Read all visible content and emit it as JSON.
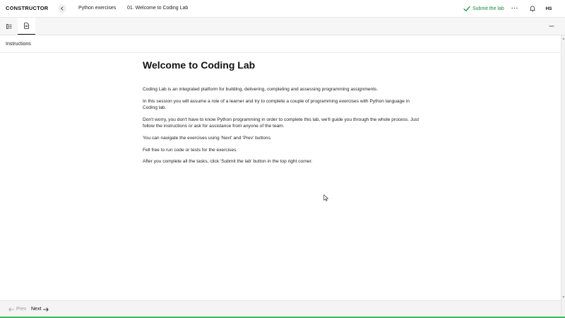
{
  "header": {
    "logo_text_left": "C",
    "logo_text_right": "NSTRUCTOR",
    "breadcrumb_course": "Python exercises",
    "breadcrumb_lesson": "01. Welcome to Coding Lab",
    "submit_label": "Submit the lab",
    "user_initials": "HS"
  },
  "toolbar": {
    "left_icon": "list-icon",
    "active_icon": "document-icon",
    "right_icon": "minus-icon"
  },
  "panel": {
    "title": "Instructions"
  },
  "content": {
    "heading": "Welcome to Coding Lab",
    "paragraphs": [
      "Coding Lab is an integrated platform for building, delivering, completing and assessing programming assignments.",
      "In this session you will assume a role of a learner and try to complete a couple of programming exercises with Python language in Coding lab.",
      "Don't worry, you don't have to know Python programming in order to complete this lab, we'll guide you through the whole process. Just follow the instructions or ask for assistance from anyone of the team.",
      "You can navigate the exercises using 'Next' and 'Prev' buttons.",
      "Fell free to run code or tests for the exercises.",
      "After you complete all the tasks, click 'Submit the lab' button in the top right corner."
    ]
  },
  "footer": {
    "prev_label": "Prev",
    "next_label": "Next"
  },
  "colors": {
    "accent_green": "#1a8a3a",
    "progress_green": "#3cba54"
  }
}
